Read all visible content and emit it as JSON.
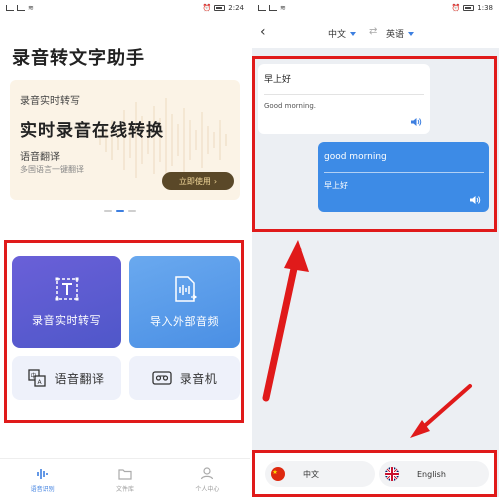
{
  "left": {
    "status": {
      "time": "2:24"
    },
    "app_title": "录音转文字助手",
    "banner": {
      "subtitle": "录音实时转写",
      "headline": "实时录音在线转换",
      "subtitle2": "语音翻译",
      "small": "多国语言一键翻译",
      "button": "立即使用"
    },
    "tiles": [
      {
        "label": "录音实时转写",
        "icon": "text-frame-icon"
      },
      {
        "label": "导入外部音频",
        "icon": "audio-file-import-icon"
      },
      {
        "label": "语音翻译",
        "icon": "translate-icon"
      },
      {
        "label": "录音机",
        "icon": "cassette-icon"
      }
    ],
    "nav": [
      {
        "label": "语音识别",
        "icon": "waveform-icon"
      },
      {
        "label": "文件库",
        "icon": "folder-icon"
      },
      {
        "label": "个人中心",
        "icon": "person-icon"
      }
    ]
  },
  "right": {
    "status": {
      "time": "1:38"
    },
    "source_lang": "中文",
    "target_lang": "英语",
    "messages": [
      {
        "original": "早上好",
        "translation": "Good morning."
      },
      {
        "original": "good morning",
        "translation": "早上好"
      }
    ],
    "bottom": {
      "lang_a": "中文",
      "lang_b": "English"
    }
  },
  "colors": {
    "accent": "#3d8be6",
    "highlight": "#e01a1a",
    "banner_button": "#5a4828"
  }
}
